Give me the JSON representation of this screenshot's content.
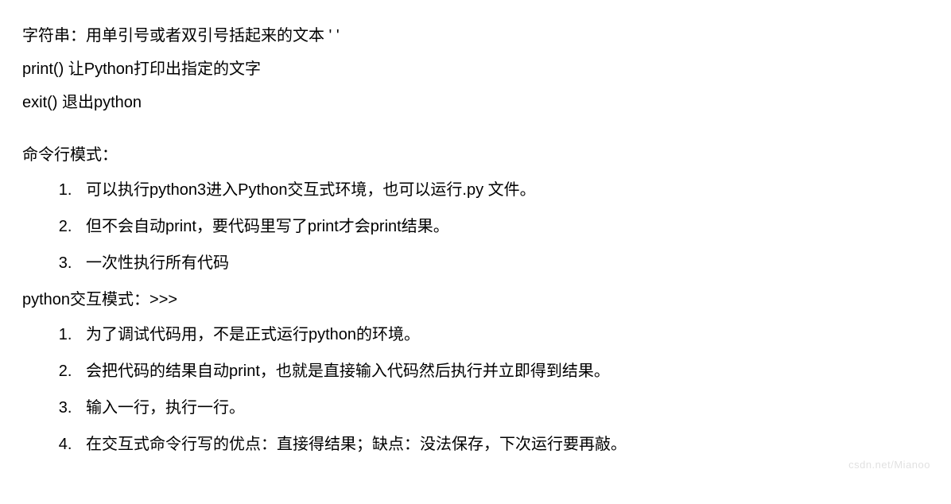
{
  "intro": {
    "line1": "字符串：用单引号或者双引号括起来的文本 '    '",
    "line2": "print() 让Python打印出指定的文字",
    "line3": "exit() 退出python"
  },
  "section1": {
    "heading": "命令行模式：",
    "items": [
      "可以执行python3进入Python交互式环境，也可以运行.py 文件。",
      " 但不会自动print，要代码里写了print才会print结果。",
      "一次性执行所有代码"
    ]
  },
  "section2": {
    "heading": "python交互模式：>>>",
    "items": [
      "为了调试代码用，不是正式运行python的环境。",
      "会把代码的结果自动print，也就是直接输入代码然后执行并立即得到结果。",
      "输入一行，执行一行。",
      "在交互式命令行写的优点：直接得结果；缺点：没法保存，下次运行要再敲。"
    ]
  },
  "watermark": "csdn.net/Mianoo"
}
